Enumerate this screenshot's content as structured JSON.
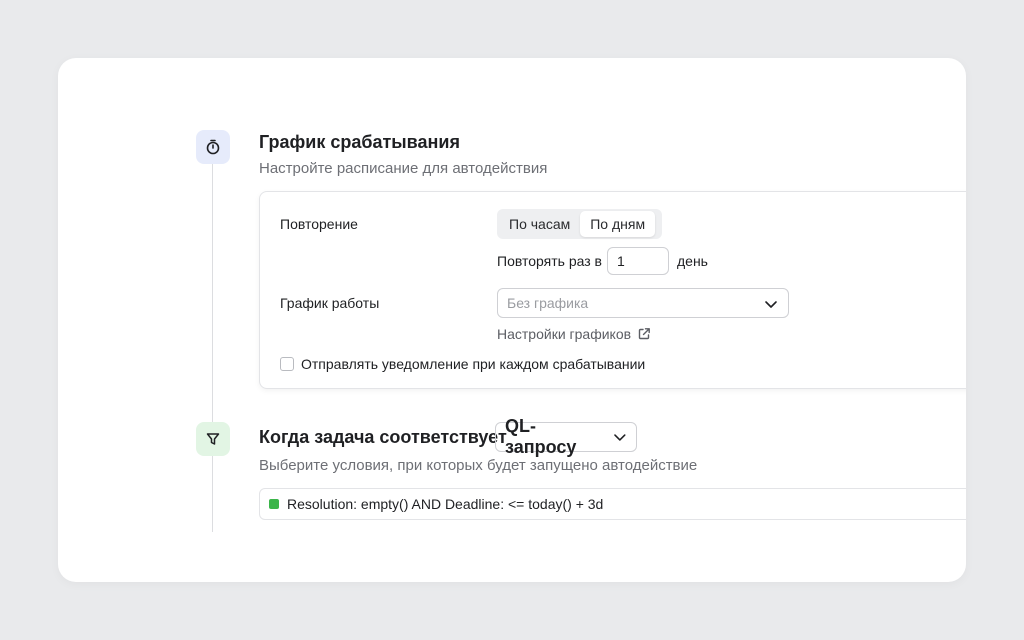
{
  "schedule": {
    "icon": "timer-icon",
    "title": "График срабатывания",
    "subtitle": "Настройте расписание для автодействия",
    "repeat_label": "Повторение",
    "segments": [
      {
        "label": "По часам",
        "active": false
      },
      {
        "label": "По дням",
        "active": true
      }
    ],
    "repeat_every_label": "Повторять раз в",
    "repeat_every_value": "1",
    "repeat_unit": "день",
    "work_schedule_label": "График работы",
    "work_schedule_placeholder": "Без графика",
    "schedule_settings_link": "Настройки графиков",
    "notify_label": "Отправлять уведомление при каждом срабатывании"
  },
  "condition": {
    "icon": "filter-icon",
    "title": "Когда задача соответствует",
    "mode_value": "QL-запросу",
    "subtitle": "Выберите условия, при которых будет запущено автодействие",
    "query": "Resolution: empty() AND Deadline: <= today() + 3d",
    "status_color": "#3bb54a"
  }
}
